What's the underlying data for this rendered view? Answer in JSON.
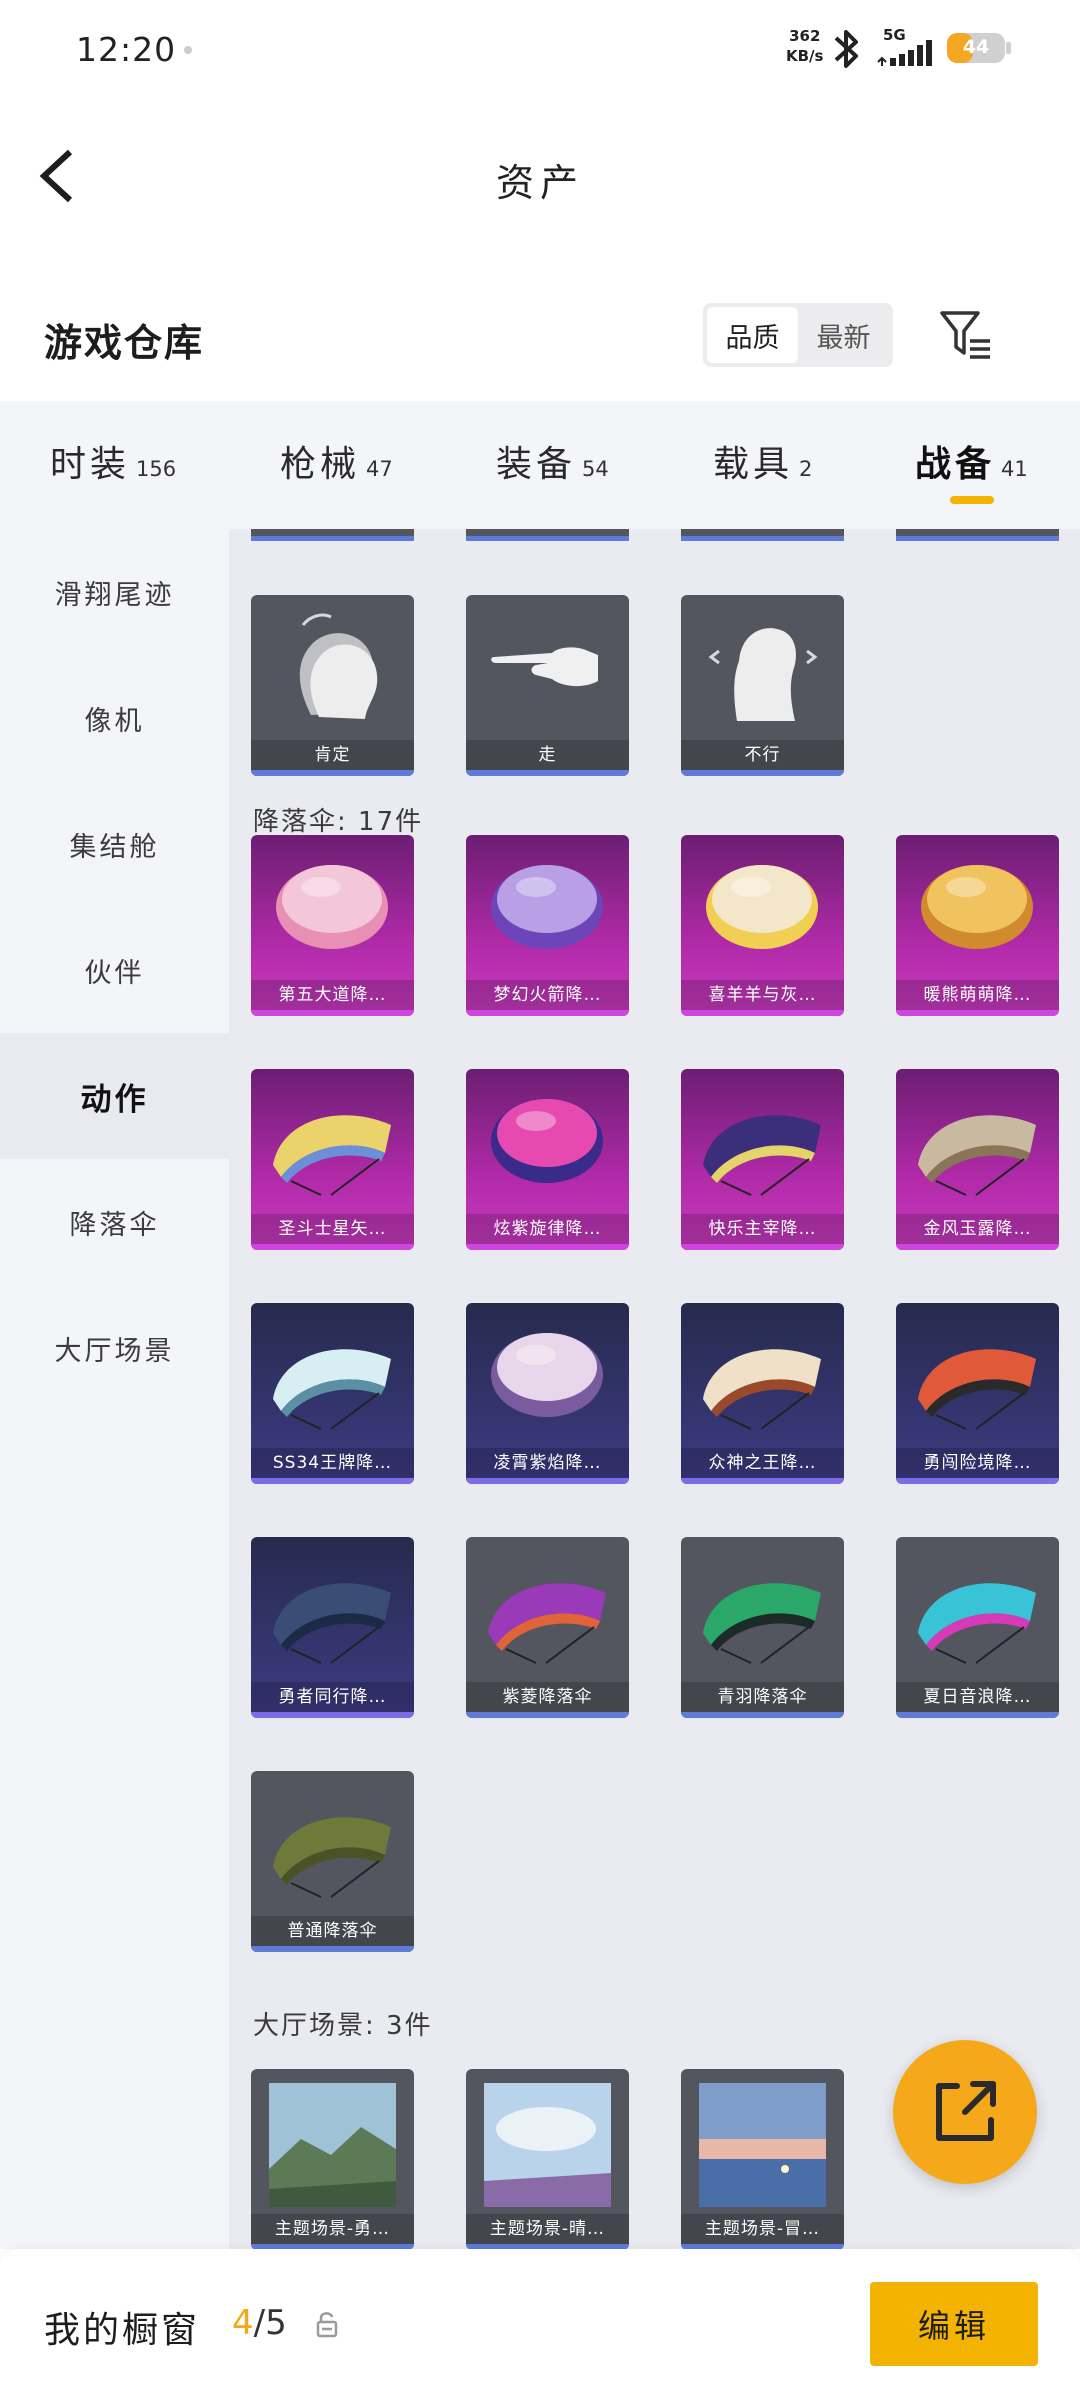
{
  "status_bar": {
    "time": "12:20",
    "net_speed_value": "362",
    "net_speed_unit": "KB/s",
    "network": "5G",
    "battery": "44",
    "battery_level": 0.44
  },
  "header": {
    "title": "资产",
    "back_icon": "chevron-left-icon"
  },
  "warehouse": {
    "title": "游戏仓库",
    "sort_options": [
      "品质",
      "最新"
    ],
    "sort_selected": "品质",
    "filter_icon": "filter-list-icon"
  },
  "tabs": [
    {
      "label": "时装",
      "count": "156",
      "active": false
    },
    {
      "label": "枪械",
      "count": "47",
      "active": false
    },
    {
      "label": "装备",
      "count": "54",
      "active": false
    },
    {
      "label": "载具",
      "count": "2",
      "active": false
    },
    {
      "label": "战备",
      "count": "41",
      "active": true
    }
  ],
  "sidebar": {
    "items": [
      {
        "label": "滑翔尾迹",
        "active": false
      },
      {
        "label": "像机",
        "active": false
      },
      {
        "label": "集结舱",
        "active": false
      },
      {
        "label": "伙伴",
        "active": false
      },
      {
        "label": "动作",
        "active": true
      },
      {
        "label": "降落伞",
        "active": false
      },
      {
        "label": "大厅场景",
        "active": false
      }
    ]
  },
  "content": {
    "emotes": [
      {
        "name": "肯定",
        "icon": "head-nod-icon"
      },
      {
        "name": "走",
        "icon": "pointing-hand-icon"
      },
      {
        "name": "不行",
        "icon": "head-shake-icon"
      }
    ],
    "parachute_section": "降落伞: 17件",
    "parachutes": [
      {
        "name": "第五大道降…",
        "tier": "pink"
      },
      {
        "name": "梦幻火箭降…",
        "tier": "pink"
      },
      {
        "name": "喜羊羊与灰…",
        "tier": "pink"
      },
      {
        "name": "暖熊萌萌降…",
        "tier": "pink"
      },
      {
        "name": "圣斗士星矢…",
        "tier": "pink"
      },
      {
        "name": "炫紫旋律降…",
        "tier": "pink"
      },
      {
        "name": "快乐主宰降…",
        "tier": "pink"
      },
      {
        "name": "金风玉露降…",
        "tier": "pink"
      },
      {
        "name": "SS34王牌降…",
        "tier": "blue"
      },
      {
        "name": "凌霄紫焰降…",
        "tier": "blue"
      },
      {
        "name": "众神之王降…",
        "tier": "blue"
      },
      {
        "name": "勇闯险境降…",
        "tier": "blue"
      },
      {
        "name": "勇者同行降…",
        "tier": "blue"
      },
      {
        "name": "紫菱降落伞",
        "tier": "grey"
      },
      {
        "name": "青羽降落伞",
        "tier": "grey"
      },
      {
        "name": "夏日音浪降…",
        "tier": "grey"
      },
      {
        "name": "普通降落伞",
        "tier": "grey"
      }
    ],
    "lobby_section": "大厅场景: 3件",
    "lobby_scenes": [
      {
        "name": "主题场景-勇…"
      },
      {
        "name": "主题场景-晴…"
      },
      {
        "name": "主题场景-冒…"
      }
    ]
  },
  "share_icon": "share-external-icon",
  "bottom_bar": {
    "label": "我的橱窗",
    "current": "4",
    "total": "/5",
    "lock_icon": "lock-icon",
    "edit_label": "编辑"
  }
}
